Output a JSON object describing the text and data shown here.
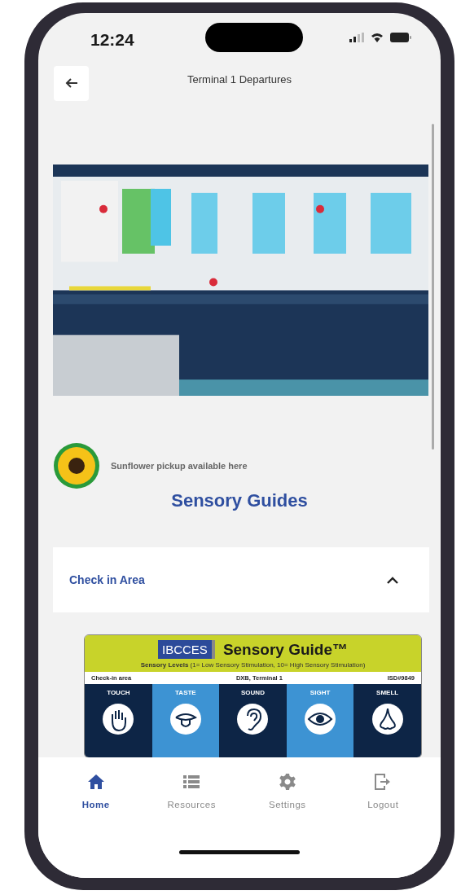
{
  "status_bar": {
    "time": "12:24"
  },
  "header": {
    "title": "Terminal 1 Departures"
  },
  "sunflower": {
    "text": "Sunflower pickup available here"
  },
  "section_title": "Sensory Guides",
  "accordion": {
    "title": "Check in Area",
    "expanded": true
  },
  "guide": {
    "logo": "IBCCES",
    "title": "Sensory Guide™",
    "subtitle": "**Sensory Levels** (1= Low Sensory Stimulation, 10= High Sensory Stimulation)",
    "area": "Check-in area",
    "location": "DXB, Terminal 1",
    "code": "ISD#9849",
    "senses": [
      {
        "label": "TOUCH",
        "kind": "touch",
        "color": "#0d2546"
      },
      {
        "label": "TASTE",
        "kind": "taste",
        "color": "#3d93d3"
      },
      {
        "label": "SOUND",
        "kind": "sound",
        "color": "#0d2546"
      },
      {
        "label": "SIGHT",
        "kind": "sight",
        "color": "#3d93d3"
      },
      {
        "label": "SMELL",
        "kind": "smell",
        "color": "#0d2546"
      }
    ]
  },
  "nav": [
    {
      "label": "Home",
      "kind": "home",
      "selected": true
    },
    {
      "label": "Resources",
      "kind": "list",
      "selected": false
    },
    {
      "label": "Settings",
      "kind": "gear",
      "selected": false
    },
    {
      "label": "Logout",
      "kind": "logout",
      "selected": false
    }
  ]
}
